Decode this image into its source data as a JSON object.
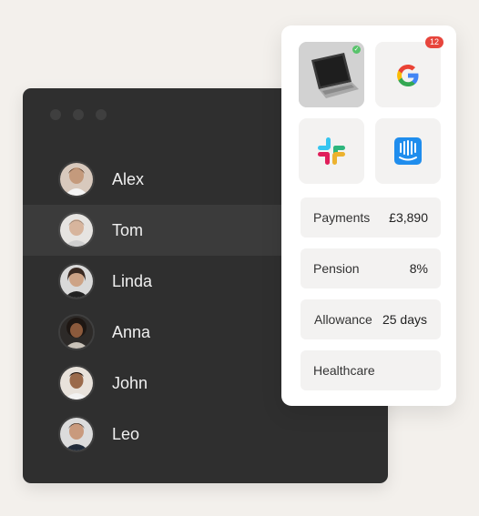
{
  "window": {
    "people": [
      {
        "name": "Alex",
        "selected": false
      },
      {
        "name": "Tom",
        "selected": true
      },
      {
        "name": "Linda",
        "selected": false
      },
      {
        "name": "Anna",
        "selected": false
      },
      {
        "name": "John",
        "selected": false
      },
      {
        "name": "Leo",
        "selected": false
      }
    ]
  },
  "panel": {
    "google_badge_count": "12",
    "benefits": [
      {
        "label": "Payments",
        "value": "£3,890"
      },
      {
        "label": "Pension",
        "value": "8%"
      },
      {
        "label": "Allowance",
        "value": "25 days"
      },
      {
        "label": "Healthcare",
        "value": ""
      }
    ]
  },
  "colors": {
    "background": "#f3f0ec",
    "window": "#2f2f2f",
    "selected_row": "#3b3b3b",
    "badge_red": "#e7453c",
    "check_green": "#58c36b",
    "intercom_blue": "#1f8ded"
  }
}
